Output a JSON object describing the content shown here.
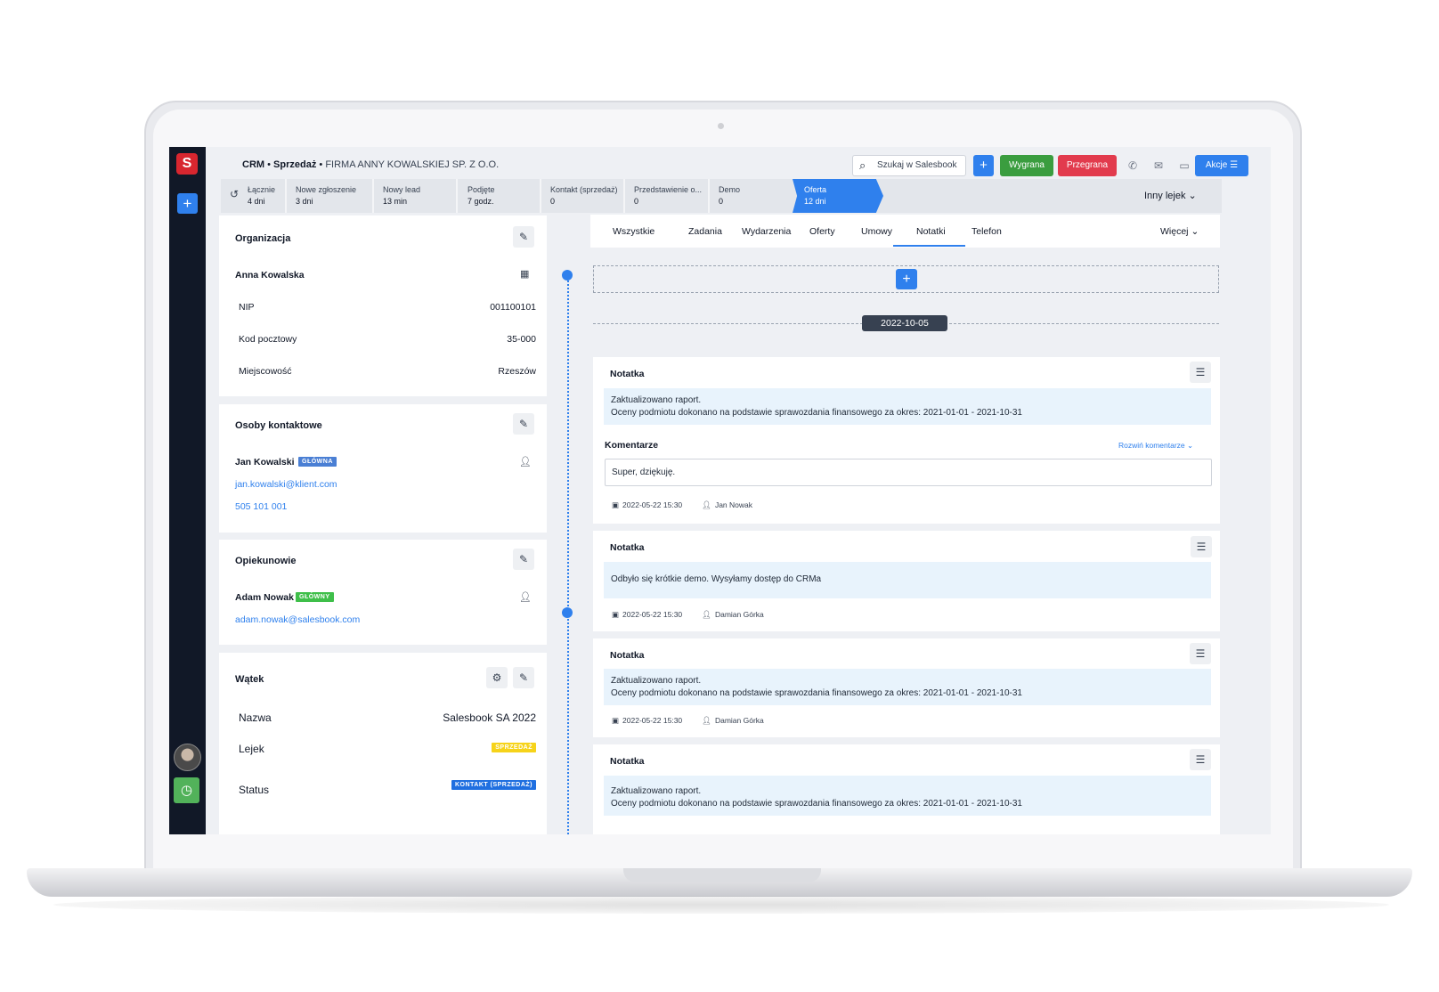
{
  "breadcrumb": {
    "crm": "CRM",
    "sep": "•",
    "sales": "Sprzedaż",
    "sep2": "•",
    "company": "FIRMA ANNY KOWALSKIEJ SP. Z O.O."
  },
  "header": {
    "search_placeholder": "Szukaj w Salesbook",
    "plus": "+",
    "won": "Wygrana",
    "lost": "Przegrana",
    "actions": "Akcje",
    "icons": [
      "phone-icon",
      "mail-icon",
      "chat-icon"
    ]
  },
  "pipeline": {
    "stages": [
      {
        "label": "Łącznie",
        "value": "4 dni"
      },
      {
        "label": "Nowe zgłoszenie",
        "value": "3 dni"
      },
      {
        "label": "Nowy lead",
        "value": "13 min"
      },
      {
        "label": "Podjęte",
        "value": "7 godz."
      },
      {
        "label": "Kontakt (sprzedaż)",
        "value": "0"
      },
      {
        "label": "Przedstawienie o...",
        "value": "0"
      },
      {
        "label": "Demo",
        "value": "0"
      },
      {
        "label": "Oferta",
        "value": "12 dni"
      }
    ],
    "other": "Inny lejek"
  },
  "org": {
    "title": "Organizacja",
    "name": "Anna Kowalska",
    "rows": [
      {
        "label": "NIP",
        "value": "001100101"
      },
      {
        "label": "Kod pocztowy",
        "value": "35-000"
      },
      {
        "label": "Miejscowość",
        "value": "Rzeszów"
      }
    ]
  },
  "contacts": {
    "title": "Osoby kontaktowe",
    "name": "Jan Kowalski",
    "badge": "GŁÓWNA",
    "email": "jan.kowalski@klient.com",
    "phone": "505 101 001"
  },
  "guardians": {
    "title": "Opiekunowie",
    "name": "Adam Nowak",
    "badge": "GŁÓWNY",
    "email": "adam.nowak@salesbook.com"
  },
  "thread": {
    "title": "Wątek",
    "rows": [
      {
        "label": "Nazwa",
        "value": "Salesbook SA 2022"
      },
      {
        "label": "Lejek",
        "value": "SPRZEDAŻ"
      },
      {
        "label": "Status",
        "value": "KONTAKT (SPRZEDAŻ)"
      }
    ]
  },
  "tabs": [
    "Wszystkie",
    "Zadania",
    "Wydarzenia",
    "Oferty",
    "Umowy",
    "Notatki",
    "Telefon"
  ],
  "active_tab": "Notatki",
  "more": "Więcej",
  "timeline": {
    "plus": "+",
    "date": "2022-10-05"
  },
  "notes": [
    {
      "title": "Notatka",
      "line1": "Zaktualizowano raport.",
      "line2": "Oceny podmiotu dokonano na podstawie sprawozdania finansowego za okres: 2021-01-01 - 2021-10-31",
      "comments_label": "Komentarze",
      "expand": "Rozwiń komentarze",
      "comment": "Super, dziękuję.",
      "date": "2022-05-22 15:30",
      "user": "Jan Nowak"
    },
    {
      "title": "Notatka",
      "line1": "Odbyło się krótkie demo. Wysyłamy dostęp do CRMa",
      "date": "2022-05-22 15:30",
      "user": "Damian Górka"
    },
    {
      "title": "Notatka",
      "line1": "Zaktualizowano raport.",
      "line2": "Oceny podmiotu dokonano na podstawie sprawozdania finansowego za okres: 2021-01-01 - 2021-10-31",
      "date": "2022-05-22 15:30",
      "user": "Damian Górka"
    },
    {
      "title": "Notatka",
      "line1": "Zaktualizowano raport.",
      "line2": "Oceny podmiotu dokonano na podstawie sprawozdania finansowego za okres: 2021-01-01 - 2021-10-31"
    }
  ],
  "colors": {
    "accent": "#2f80ed",
    "won": "#3a9d3f",
    "lost": "#e23b4d",
    "sidebar": "#111827",
    "note_bg": "#e8f3fc"
  }
}
